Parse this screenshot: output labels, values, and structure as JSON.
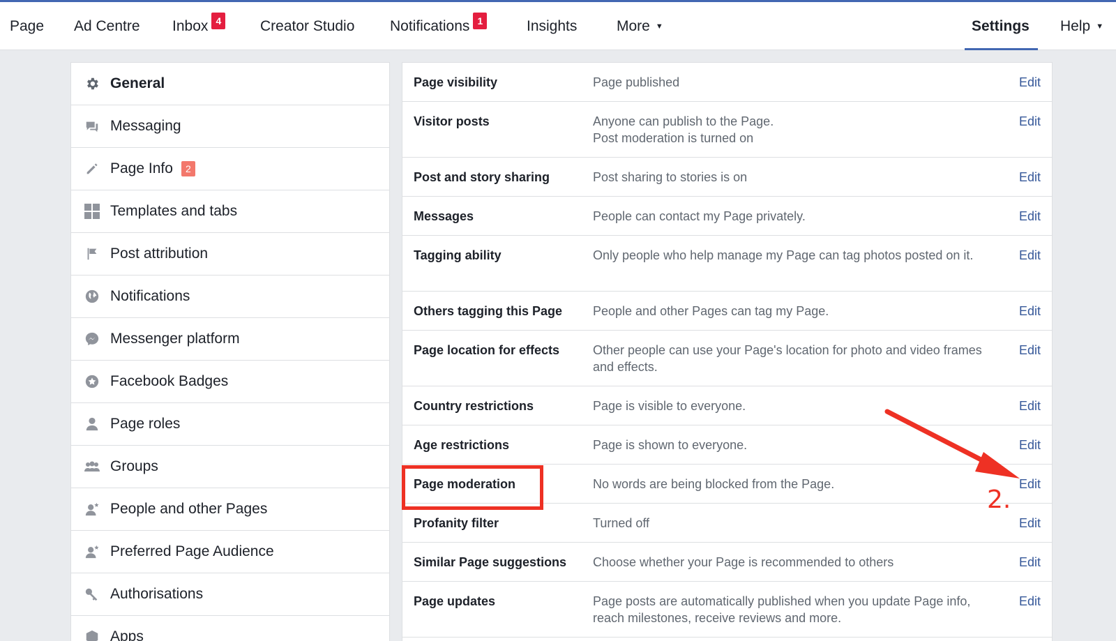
{
  "nav": {
    "items": [
      {
        "label": "Page"
      },
      {
        "label": "Ad Centre"
      },
      {
        "label": "Inbox",
        "badge": "4"
      },
      {
        "label": "Creator Studio"
      },
      {
        "label": "Notifications",
        "badge": "1"
      },
      {
        "label": "Insights"
      },
      {
        "label": "More"
      },
      {
        "label": "Settings"
      },
      {
        "label": "Help"
      }
    ],
    "active": "Settings",
    "accent_color": "#4267b2",
    "badge_color": "#e41e3f"
  },
  "sidebar": {
    "items": [
      {
        "label": "General",
        "icon": "gear-icon"
      },
      {
        "label": "Messaging",
        "icon": "chat-bubbles-icon"
      },
      {
        "label": "Page Info",
        "icon": "pencil-icon",
        "badge": "2"
      },
      {
        "label": "Templates and tabs",
        "icon": "grid-icon"
      },
      {
        "label": "Post attribution",
        "icon": "flag-icon"
      },
      {
        "label": "Notifications",
        "icon": "globe-icon"
      },
      {
        "label": "Messenger platform",
        "icon": "messenger-icon"
      },
      {
        "label": "Facebook Badges",
        "icon": "star-badge-icon"
      },
      {
        "label": "Page roles",
        "icon": "person-icon"
      },
      {
        "label": "Groups",
        "icon": "group-icon"
      },
      {
        "label": "People and other Pages",
        "icon": "person-star-icon"
      },
      {
        "label": "Preferred Page Audience",
        "icon": "person-star-icon"
      },
      {
        "label": "Authorisations",
        "icon": "key-icon"
      },
      {
        "label": "Apps",
        "icon": "box-icon"
      }
    ],
    "active": "General"
  },
  "settings": {
    "edit_label": "Edit",
    "rows": [
      {
        "label": "Page visibility",
        "value": "Page published"
      },
      {
        "label": "Visitor posts",
        "value": "Anyone can publish to the Page.\nPost moderation is turned on"
      },
      {
        "label": "Post and story sharing",
        "value": "Post sharing to stories is on"
      },
      {
        "label": "Messages",
        "value": "People can contact my Page privately."
      },
      {
        "label": "Tagging ability",
        "value": "Only people who help manage my Page can tag photos posted on it."
      },
      {
        "label": "Others tagging this Page",
        "value": "People and other Pages can tag my Page."
      },
      {
        "label": "Page location for effects",
        "value": "Other people can use your Page's location for photo and video frames and effects."
      },
      {
        "label": "Country restrictions",
        "value": "Page is visible to everyone."
      },
      {
        "label": "Age restrictions",
        "value": "Page is shown to everyone."
      },
      {
        "label": "Page moderation",
        "value": "No words are being blocked from the Page."
      },
      {
        "label": "Profanity filter",
        "value": "Turned off"
      },
      {
        "label": "Similar Page suggestions",
        "value": "Choose whether your Page is recommended to others"
      },
      {
        "label": "Page updates",
        "value": "Page posts are automatically published when you update Page info, reach milestones, receive reviews and more."
      }
    ]
  },
  "annotation": {
    "step_label": "2.",
    "highlighted_row": "Page moderation",
    "color": "#ee3124"
  }
}
